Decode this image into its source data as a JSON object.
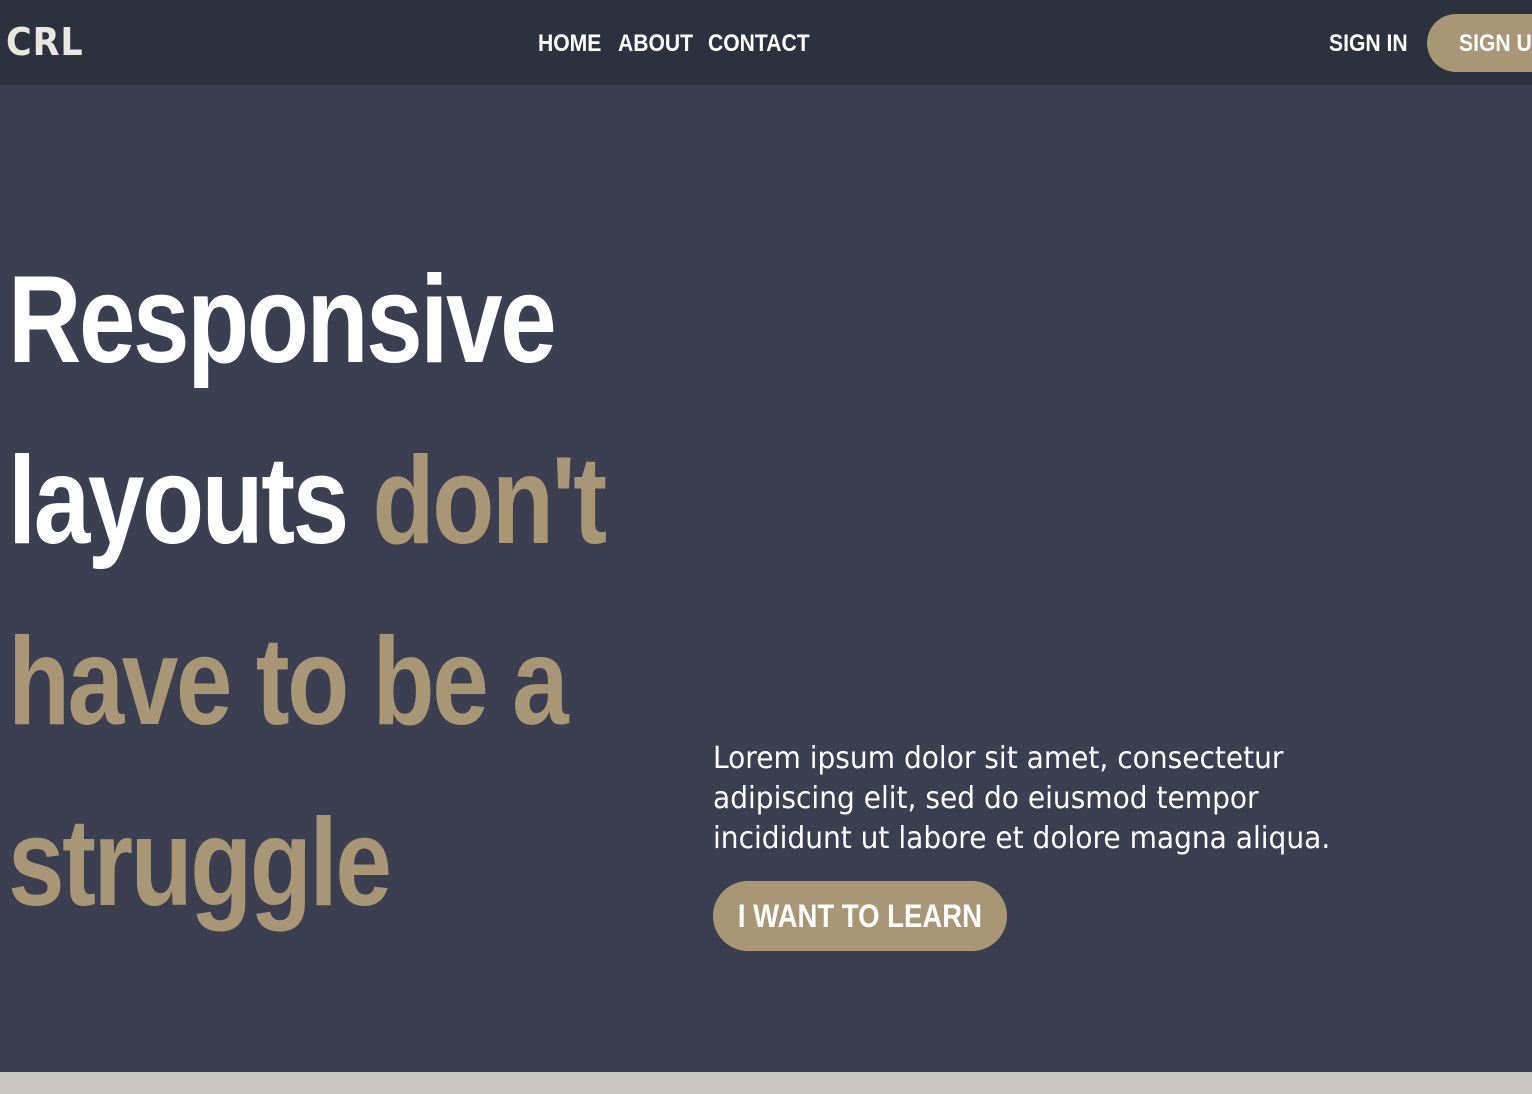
{
  "brand": {
    "logo_text": "CRL"
  },
  "nav": {
    "items": [
      {
        "label": "HOME"
      },
      {
        "label": "ABOUT"
      },
      {
        "label": "CONTACT"
      }
    ],
    "sign_in_label": "SIGN IN",
    "sign_up_label": "SIGN UP"
  },
  "hero": {
    "heading": {
      "line1": "Responsive",
      "line2_white": "layouts",
      "line2_accent": "don't",
      "line3": "have to be a",
      "line4": "struggle"
    },
    "paragraph": {
      "line1": "Lorem ipsum dolor sit amet, consectetur",
      "line2": "adipiscing elit, sed do eiusmod tempor",
      "line3": "incididunt ut labore et dolore magna aliqua."
    },
    "cta_label": "I WANT TO LEARN"
  },
  "colors": {
    "navbar_bg": "#2d303d",
    "page_bg": "#3b3f50",
    "accent": "#a89776",
    "text": "#ffffff",
    "bottom_band": "#c9c8c1"
  }
}
